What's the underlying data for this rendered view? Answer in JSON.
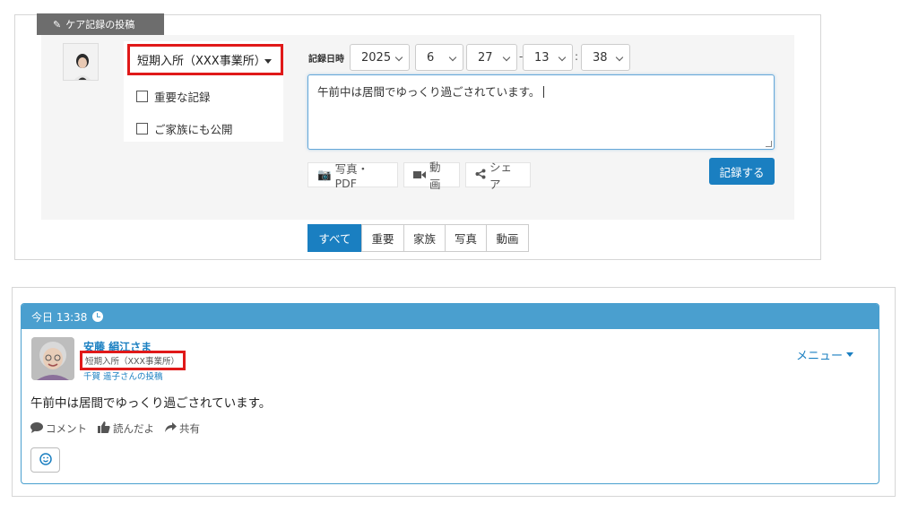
{
  "panel": {
    "tab_label": "ケア記録の投稿",
    "office_select": "短期入所（XXX事業所）",
    "checkbox_important": "重要な記録",
    "checkbox_family": "ご家族にも公開",
    "datetime_label": "記録日時",
    "year": "2025",
    "month": "6",
    "day": "27",
    "hour": "13",
    "minute": "38",
    "date_sep": "-",
    "time_sep": ":",
    "textarea_value": "午前中は居間でゆっくり過ごされています。",
    "photo_btn": "写真・PDF",
    "video_btn": "動画",
    "share_btn": "シェア",
    "submit_btn": "記録する"
  },
  "filters": [
    "すべて",
    "重要",
    "家族",
    "写真",
    "動画"
  ],
  "post": {
    "timestamp": "今日 13:38",
    "author": "安藤 絹江さま",
    "office": "短期入所（XXX事業所）",
    "poster": "千賀 遥子さんの投稿",
    "menu": "メニュー",
    "body": "午前中は居間でゆっくり過ごされています。",
    "comment": "コメント",
    "like": "読んだよ",
    "share": "共有"
  },
  "colors": {
    "accent": "#1a7fc1",
    "header": "#4a9fcf",
    "highlight": "#e01919"
  }
}
